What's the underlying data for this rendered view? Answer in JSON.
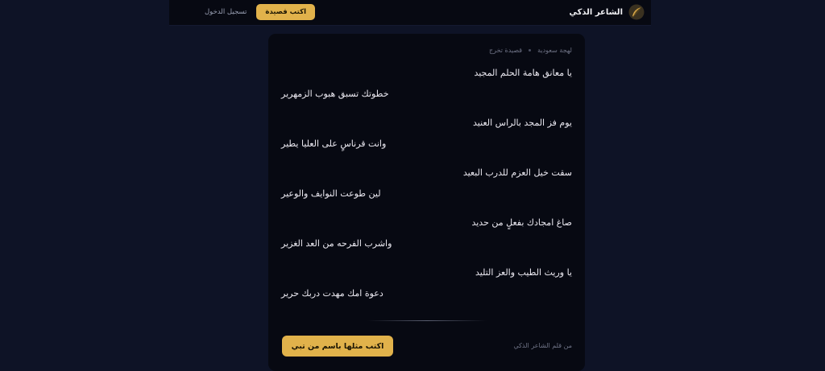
{
  "header": {
    "brand": "الشاعر الذكي",
    "logo_icon": "quill-feather-icon",
    "write_button": "اكتب قصيدة",
    "login_link": "تسجيل الدخول",
    "accent_color": "#e1b24b"
  },
  "poem": {
    "meta_type": "قصيدة تخرج",
    "meta_dialect": "لهجة سعودية",
    "verses": [
      [
        "يا معانق هامة الحلم المجيد",
        "خطوتك تسبق هبوب الزمهرير"
      ],
      [
        "يوم فز المجد بالراس العنيد",
        "وانت قرناسٍ على العليا يطير"
      ],
      [
        "سقت خيل العزم للدرب البعيد",
        "لين طوعت النوايف والوعير"
      ],
      [
        "صاغ امجادك بفعلٍ من حديد",
        "واشرب الفرحه من العد الغزير"
      ],
      [
        "يا وريث الطيب والعز التليد",
        "دعوة امك مهدت دربك حرير"
      ]
    ],
    "footer_note": "من قلم الشاعر الذكي",
    "cta_button": "اكتب مثلها باسم من تبي"
  }
}
